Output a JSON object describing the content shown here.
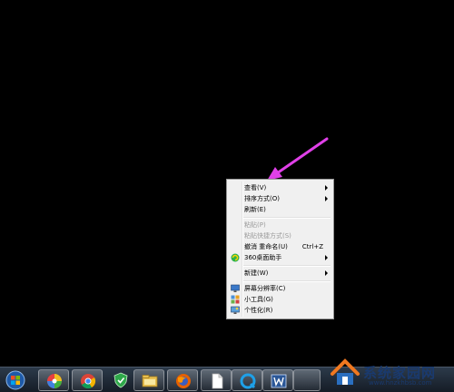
{
  "context_menu": {
    "items": [
      {
        "label": "查看(V)",
        "submenu": true
      },
      {
        "label": "排序方式(O)",
        "submenu": true
      },
      {
        "label": "刷新(E)"
      },
      {
        "label": "粘贴(P)",
        "disabled": true
      },
      {
        "label": "粘贴快捷方式(S)",
        "disabled": true
      },
      {
        "label": "撤消 重命名(U)",
        "shortcut": "Ctrl+Z"
      },
      {
        "label": "360桌面助手",
        "submenu": true,
        "icon": "360-assistant-icon"
      },
      {
        "label": "新建(W)",
        "submenu": true
      },
      {
        "label": "屏幕分辨率(C)",
        "icon": "screen-resolution-icon"
      },
      {
        "label": "小工具(G)",
        "icon": "gadgets-icon"
      },
      {
        "label": "个性化(R)",
        "icon": "personalize-icon"
      }
    ]
  },
  "annotation": {
    "color": "#e040e8"
  },
  "taskbar": {
    "items": [
      "start-orb-icon",
      "color-wheel-icon",
      "chrome-icon",
      "security-shield-icon",
      "file-explorer-icon",
      "firefox-icon",
      "blank-document-icon",
      "qq-browser-icon",
      "word-icon"
    ]
  },
  "watermark": {
    "text": "系统家园网",
    "url": "www.hnzkhbsb.com"
  }
}
